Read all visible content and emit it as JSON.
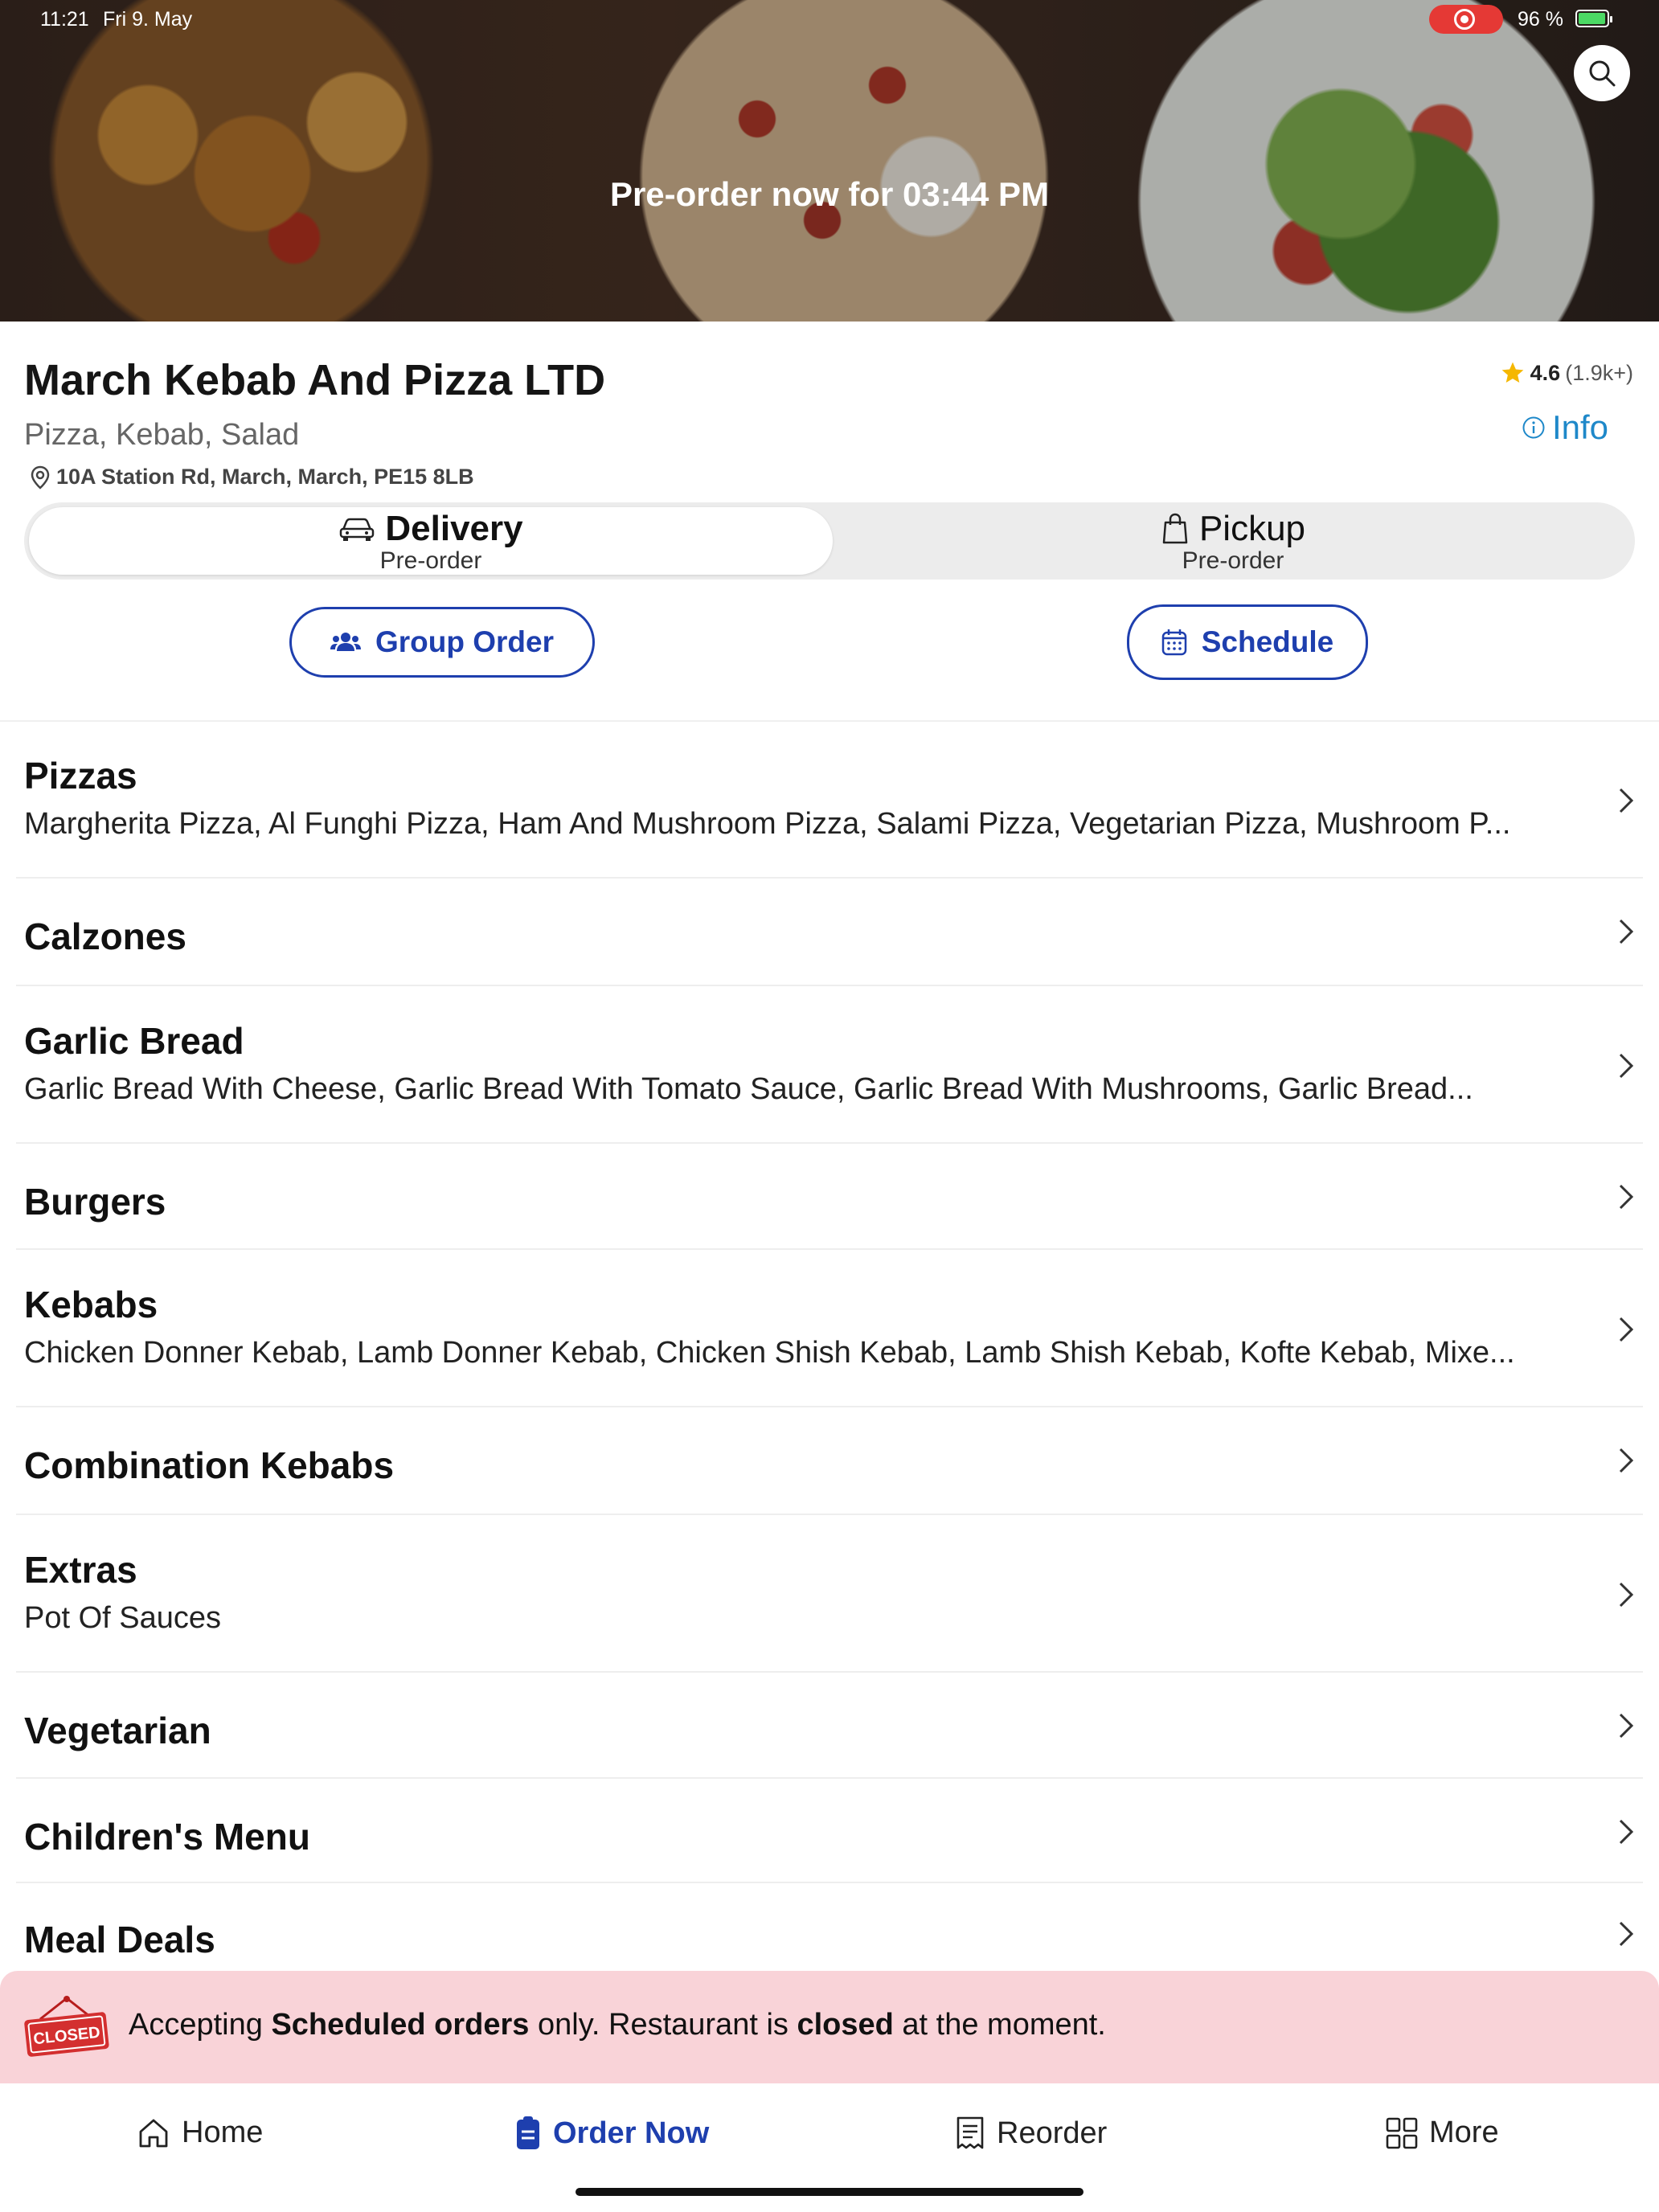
{
  "status_bar": {
    "time": "11:21",
    "date": "Fri 9. May",
    "battery": "96 %",
    "battery_level": 0.96
  },
  "hero": {
    "preorder_text": "Pre-order now for 03:44 PM",
    "search_icon": "search-icon"
  },
  "restaurant": {
    "name": "March Kebab And Pizza LTD",
    "cuisines": "Pizza, Kebab, Salad",
    "address": "10A Station Rd, March, March, PE15 8LB",
    "rating": "4.6",
    "rating_count": "(1.9k+)",
    "info_label": "Info"
  },
  "order_mode": {
    "delivery": {
      "label": "Delivery",
      "sub": "Pre-order",
      "selected": true
    },
    "pickup": {
      "label": "Pickup",
      "sub": "Pre-order",
      "selected": false
    }
  },
  "actions": {
    "group_order": "Group Order",
    "schedule": "Schedule"
  },
  "categories": [
    {
      "name": "Pizzas",
      "items": "Margherita Pizza, Al Funghi Pizza, Ham And Mushroom Pizza, Salami Pizza, Vegetarian Pizza, Mushroom P..."
    },
    {
      "name": "Calzones",
      "items": ""
    },
    {
      "name": "Garlic Bread",
      "items": "Garlic Bread With Cheese, Garlic Bread With Tomato Sauce, Garlic Bread With Mushrooms, Garlic Bread..."
    },
    {
      "name": "Burgers",
      "items": ""
    },
    {
      "name": "Kebabs",
      "items": "Chicken Donner Kebab, Lamb Donner Kebab, Chicken Shish Kebab, Lamb Shish Kebab, Kofte Kebab, Mixe..."
    },
    {
      "name": "Combination Kebabs",
      "items": ""
    },
    {
      "name": "Extras",
      "items": "Pot Of Sauces"
    },
    {
      "name": "Vegetarian",
      "items": ""
    },
    {
      "name": "Children's Menu",
      "items": ""
    },
    {
      "name": "Meal Deals",
      "items": ""
    }
  ],
  "closed_banner": {
    "sign": "CLOSED",
    "text_1": "Accepting ",
    "text_bold_1": "Scheduled orders",
    "text_2": " only. Restaurant is ",
    "text_bold_2": "closed",
    "text_3": " at the moment."
  },
  "bottom_nav": [
    {
      "label": "Home",
      "icon": "home-icon",
      "active": false
    },
    {
      "label": "Order Now",
      "icon": "order-icon",
      "active": true
    },
    {
      "label": "Reorder",
      "icon": "receipt-icon",
      "active": false
    },
    {
      "label": "More",
      "icon": "grid-icon",
      "active": false
    }
  ],
  "colors": {
    "accent": "#1e3fae",
    "info": "#1e88c9",
    "closed_bg": "#f9d3d8",
    "star": "#f5b700"
  }
}
